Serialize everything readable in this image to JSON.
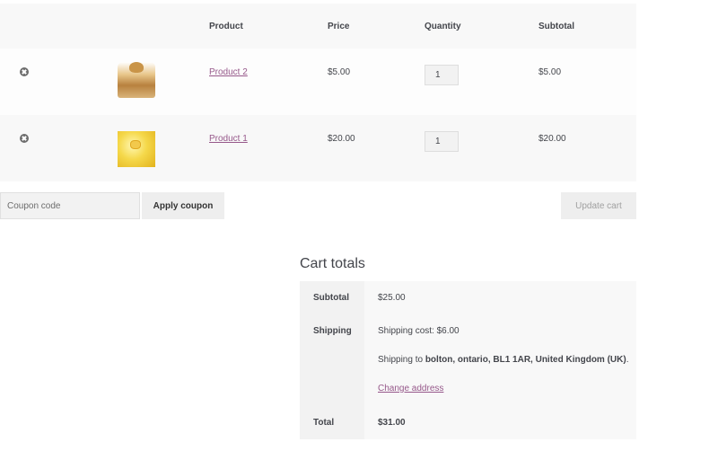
{
  "cart": {
    "headers": {
      "product": "Product",
      "price": "Price",
      "quantity": "Quantity",
      "subtotal": "Subtotal"
    },
    "items": [
      {
        "name": "Product 2",
        "price": "$5.00",
        "quantity": "1",
        "subtotal": "$5.00",
        "remove_icon": "remove-circle-icon"
      },
      {
        "name": "Product 1",
        "price": "$20.00",
        "quantity": "1",
        "subtotal": "$20.00",
        "remove_icon": "remove-circle-icon"
      }
    ],
    "coupon_placeholder": "Coupon code",
    "apply_coupon_label": "Apply coupon",
    "update_cart_label": "Update cart"
  },
  "totals": {
    "title": "Cart totals",
    "subtotal_label": "Subtotal",
    "subtotal_value": "$25.00",
    "shipping_label": "Shipping",
    "shipping_cost": "Shipping cost: $6.00",
    "shipping_to_prefix": "Shipping to",
    "shipping_address": "bolton, ontario, BL1 1AR, United Kingdom (UK)",
    "shipping_to_suffix": ".",
    "change_address_label": "Change address",
    "total_label": "Total",
    "total_value": "$31.00"
  },
  "colors": {
    "link": "#96588a",
    "text": "#43454b",
    "row_bg": "#f8f8f8"
  }
}
